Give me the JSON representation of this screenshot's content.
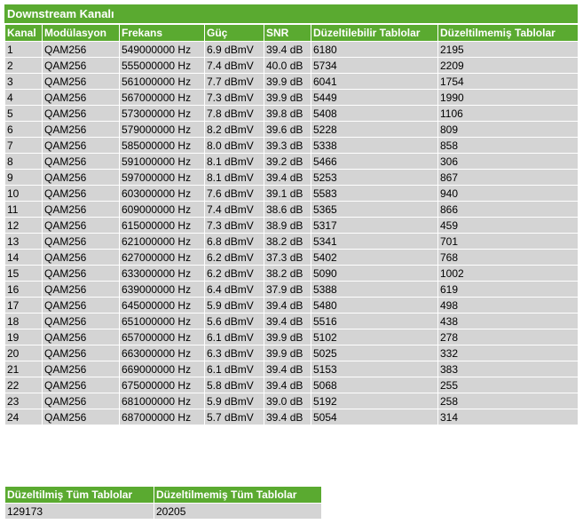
{
  "downstream": {
    "title": "Downstream Kanalı",
    "columns": [
      "Kanal",
      "Modülasyon",
      "Frekans",
      "Güç",
      "SNR",
      "Düzeltilebilir Tablolar",
      "Düzeltilmemiş Tablolar"
    ],
    "rows": [
      [
        "1",
        "QAM256",
        "549000000 Hz",
        "6.9 dBmV",
        "39.4 dB",
        "6180",
        "2195"
      ],
      [
        "2",
        "QAM256",
        "555000000 Hz",
        "7.4 dBmV",
        "40.0 dB",
        "5734",
        "2209"
      ],
      [
        "3",
        "QAM256",
        "561000000 Hz",
        "7.7 dBmV",
        "39.9 dB",
        "6041",
        "1754"
      ],
      [
        "4",
        "QAM256",
        "567000000 Hz",
        "7.3 dBmV",
        "39.9 dB",
        "5449",
        "1990"
      ],
      [
        "5",
        "QAM256",
        "573000000 Hz",
        "7.8 dBmV",
        "39.8 dB",
        "5408",
        "1106"
      ],
      [
        "6",
        "QAM256",
        "579000000 Hz",
        "8.2 dBmV",
        "39.6 dB",
        "5228",
        "809"
      ],
      [
        "7",
        "QAM256",
        "585000000 Hz",
        "8.0 dBmV",
        "39.3 dB",
        "5338",
        "858"
      ],
      [
        "8",
        "QAM256",
        "591000000 Hz",
        "8.1 dBmV",
        "39.2 dB",
        "5466",
        "306"
      ],
      [
        "9",
        "QAM256",
        "597000000 Hz",
        "8.1 dBmV",
        "39.4 dB",
        "5253",
        "867"
      ],
      [
        "10",
        "QAM256",
        "603000000 Hz",
        "7.6 dBmV",
        "39.1 dB",
        "5583",
        "940"
      ],
      [
        "11",
        "QAM256",
        "609000000 Hz",
        "7.4 dBmV",
        "38.6 dB",
        "5365",
        "866"
      ],
      [
        "12",
        "QAM256",
        "615000000 Hz",
        "7.3 dBmV",
        "38.9 dB",
        "5317",
        "459"
      ],
      [
        "13",
        "QAM256",
        "621000000 Hz",
        "6.8 dBmV",
        "38.2 dB",
        "5341",
        "701"
      ],
      [
        "14",
        "QAM256",
        "627000000 Hz",
        "6.2 dBmV",
        "37.3 dB",
        "5402",
        "768"
      ],
      [
        "15",
        "QAM256",
        "633000000 Hz",
        "6.2 dBmV",
        "38.2 dB",
        "5090",
        "1002"
      ],
      [
        "16",
        "QAM256",
        "639000000 Hz",
        "6.4 dBmV",
        "37.9 dB",
        "5388",
        "619"
      ],
      [
        "17",
        "QAM256",
        "645000000 Hz",
        "5.9 dBmV",
        "39.4 dB",
        "5480",
        "498"
      ],
      [
        "18",
        "QAM256",
        "651000000 Hz",
        "5.6 dBmV",
        "39.4 dB",
        "5516",
        "438"
      ],
      [
        "19",
        "QAM256",
        "657000000 Hz",
        "6.1 dBmV",
        "39.9 dB",
        "5102",
        "278"
      ],
      [
        "20",
        "QAM256",
        "663000000 Hz",
        "6.3 dBmV",
        "39.9 dB",
        "5025",
        "332"
      ],
      [
        "21",
        "QAM256",
        "669000000 Hz",
        "6.1 dBmV",
        "39.4 dB",
        "5153",
        "383"
      ],
      [
        "22",
        "QAM256",
        "675000000 Hz",
        "5.8 dBmV",
        "39.4 dB",
        "5068",
        "255"
      ],
      [
        "23",
        "QAM256",
        "681000000 Hz",
        "5.9 dBmV",
        "39.0 dB",
        "5192",
        "258"
      ],
      [
        "24",
        "QAM256",
        "687000000 Hz",
        "5.7 dBmV",
        "39.4 dB",
        "5054",
        "314"
      ]
    ]
  },
  "totals": {
    "columns": [
      "Düzeltilmiş Tüm Tablolar",
      "Düzeltilmemiş Tüm Tablolar"
    ],
    "values": [
      "129173",
      "20205"
    ]
  },
  "colors": {
    "header_green": "#5aaa30",
    "cell_gray": "#d4d4d4"
  }
}
